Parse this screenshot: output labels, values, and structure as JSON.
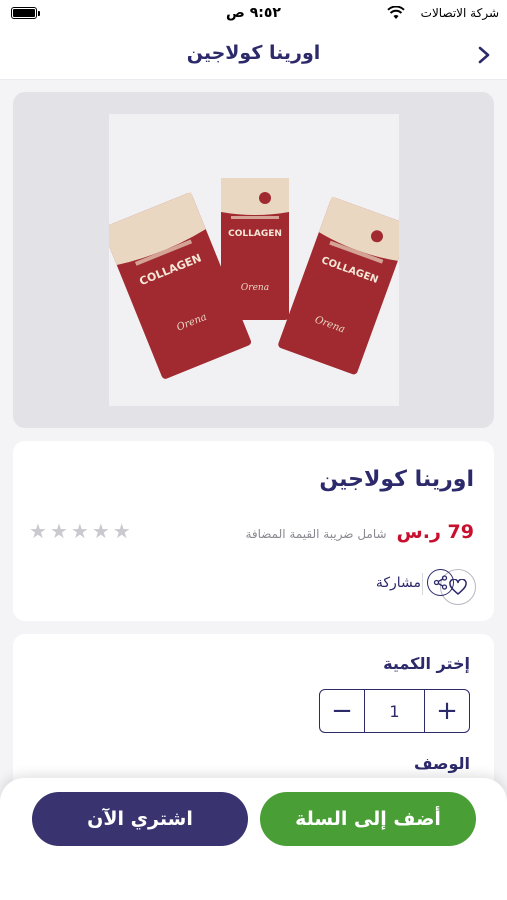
{
  "status_bar": {
    "time": "٩:٥٢ ص",
    "carrier": "شركة الاتصالات",
    "icons": [
      "battery-icon",
      "wifi-icon"
    ]
  },
  "nav": {
    "title": "اورينا كولاجين",
    "back_icon": "chevron-right-icon"
  },
  "product_image": {
    "pack_brand": "COLLAGEN",
    "pack_signature": "Orena",
    "pack_color": "#a02a30",
    "top_color": "#ead7c2"
  },
  "product": {
    "title": "اورينا كولاجين",
    "price": "79 ر.س",
    "vat_note": "شامل ضريبة القيمة المضافة",
    "rating": 0,
    "max_rating": 5,
    "star_glyph": "★",
    "share_label": "مشاركة"
  },
  "quantity": {
    "label": "إختر الكمية",
    "value": "1",
    "minus": "−",
    "plus": "+"
  },
  "description": {
    "label": "الوصف"
  },
  "actions": {
    "add_to_cart": "أضف إلى السلة",
    "buy_now": "اشتري الآن"
  },
  "colors": {
    "primary": "#2d2a6b",
    "price": "#c8102e",
    "cart_button": "#4a9e36",
    "buy_button": "#39336f"
  }
}
